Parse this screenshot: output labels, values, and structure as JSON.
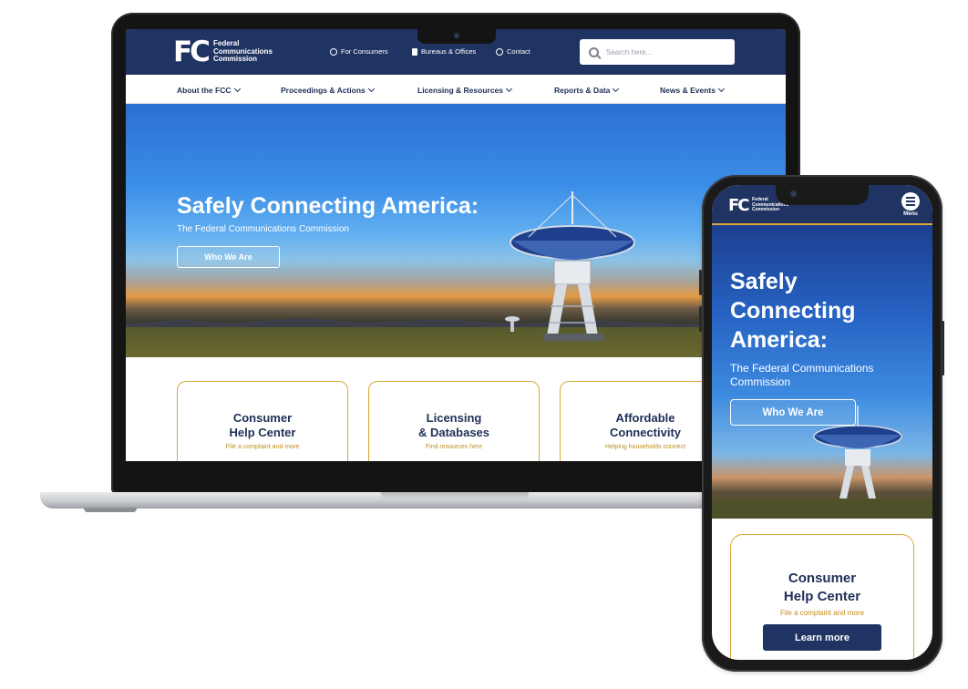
{
  "desktop": {
    "logo": {
      "mark": "FC",
      "lines": [
        "Federal",
        "Communications",
        "Commission"
      ]
    },
    "utility_links": [
      {
        "label": "For Consumers",
        "icon": "location-pin-icon"
      },
      {
        "label": "Bureaus & Offices",
        "icon": "building-icon"
      },
      {
        "label": "Contact",
        "icon": "question-circle-icon"
      }
    ],
    "search": {
      "placeholder": "Search here..."
    },
    "nav": [
      "About the FCC",
      "Proceedings & Actions",
      "Licensing & Resources",
      "Reports & Data",
      "News & Events"
    ],
    "hero": {
      "title": "Safely Connecting America:",
      "subtitle": "The Federal Communications Commission",
      "button": "Who We Are"
    },
    "cards": [
      {
        "title_line1": "Consumer",
        "title_line2": "Help Center",
        "subtitle": "File a complaint and more"
      },
      {
        "title_line1": "Licensing",
        "title_line2": "& Databases",
        "subtitle": "Find resources here"
      },
      {
        "title_line1": "Affordable",
        "title_line2": "Connectivity",
        "subtitle": "Helping households connect"
      }
    ]
  },
  "mobile": {
    "logo": {
      "mark": "FC",
      "lines": [
        "Federal",
        "Communications",
        "Commission"
      ]
    },
    "menu_label": "Menu",
    "hero": {
      "title_lines": [
        "Safely",
        "Connecting",
        "America:"
      ],
      "subtitle": "The Federal Communications Commission",
      "button": "Who We Are"
    },
    "card": {
      "title_line1": "Consumer",
      "title_line2": "Help Center",
      "subtitle": "File a complaint and more",
      "button": "Learn more"
    }
  },
  "colors": {
    "navy": "#203463",
    "gold": "#d9a53b",
    "text_navy": "#1f2f56"
  }
}
